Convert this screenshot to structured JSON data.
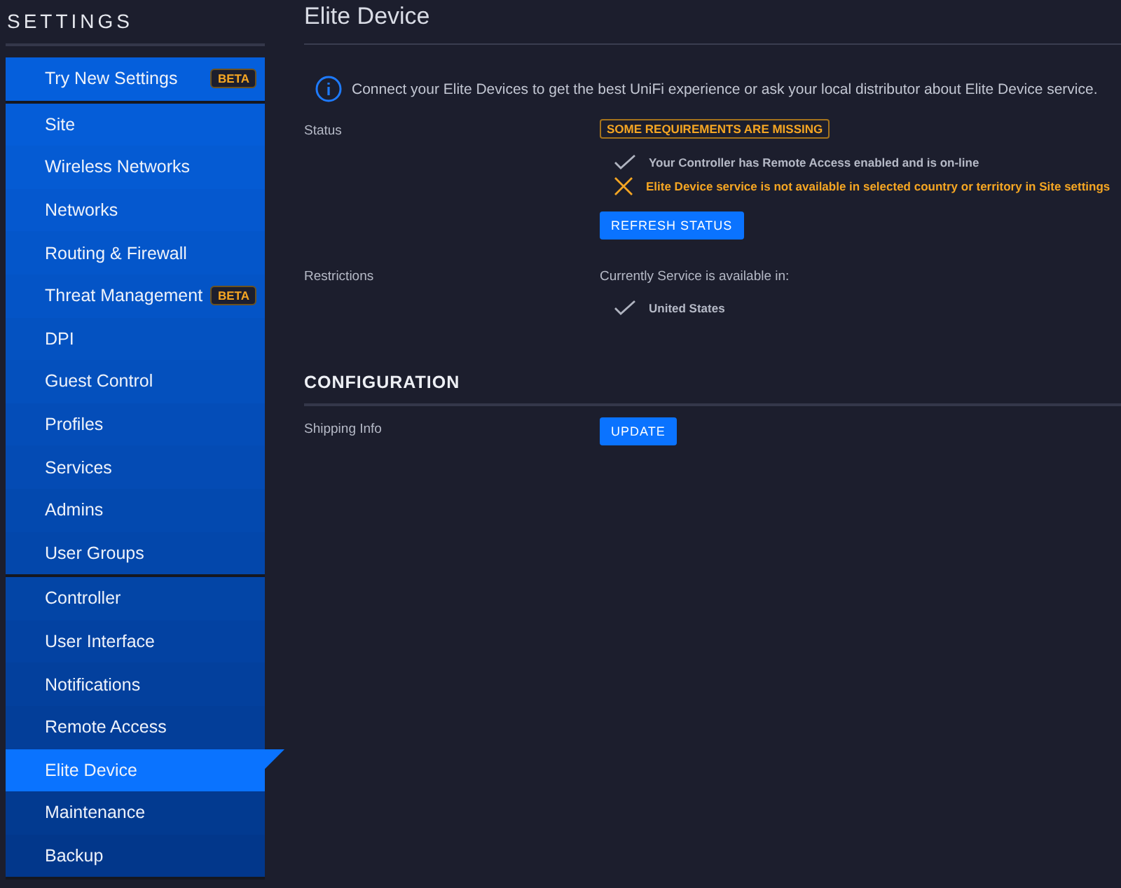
{
  "sidebar": {
    "title": "SETTINGS",
    "groups": [
      {
        "items": [
          {
            "label": "Try New Settings",
            "badge": "BETA",
            "selected": false
          }
        ]
      },
      {
        "items": [
          {
            "label": "Site",
            "selected": false
          },
          {
            "label": "Wireless Networks",
            "selected": false
          },
          {
            "label": "Networks",
            "selected": false
          },
          {
            "label": "Routing & Firewall",
            "selected": false
          },
          {
            "label": "Threat Management",
            "badge": "BETA",
            "selected": false
          },
          {
            "label": "DPI",
            "selected": false
          },
          {
            "label": "Guest Control",
            "selected": false
          },
          {
            "label": "Profiles",
            "selected": false
          },
          {
            "label": "Services",
            "selected": false
          },
          {
            "label": "Admins",
            "selected": false
          },
          {
            "label": "User Groups",
            "selected": false
          }
        ]
      },
      {
        "items": [
          {
            "label": "Controller",
            "selected": false
          },
          {
            "label": "User Interface",
            "selected": false
          },
          {
            "label": "Notifications",
            "selected": false
          },
          {
            "label": "Remote Access",
            "selected": false
          },
          {
            "label": "Elite Device",
            "selected": true
          },
          {
            "label": "Maintenance",
            "selected": false
          },
          {
            "label": "Backup",
            "selected": false
          }
        ]
      }
    ]
  },
  "page": {
    "title": "Elite Device",
    "info": "Connect your Elite Devices to get the best UniFi experience or ask your local distributor about Elite Device service.",
    "status": {
      "label": "Status",
      "badge": "SOME REQUIREMENTS ARE MISSING",
      "requirements": [
        {
          "kind": "met",
          "text": "Your Controller has Remote Access enabled and is on-line"
        },
        {
          "kind": "missing",
          "text": "Elite Device service is not available in selected country or territory in Site settings"
        }
      ],
      "button": "REFRESH STATUS"
    },
    "restrictions": {
      "label": "Restrictions",
      "intro": "Currently Service is available in:",
      "countries": [
        "United States"
      ]
    },
    "configuration": {
      "heading": "CONFIGURATION",
      "rows": [
        {
          "label": "Shipping Info",
          "button": "UPDATE"
        }
      ]
    }
  }
}
